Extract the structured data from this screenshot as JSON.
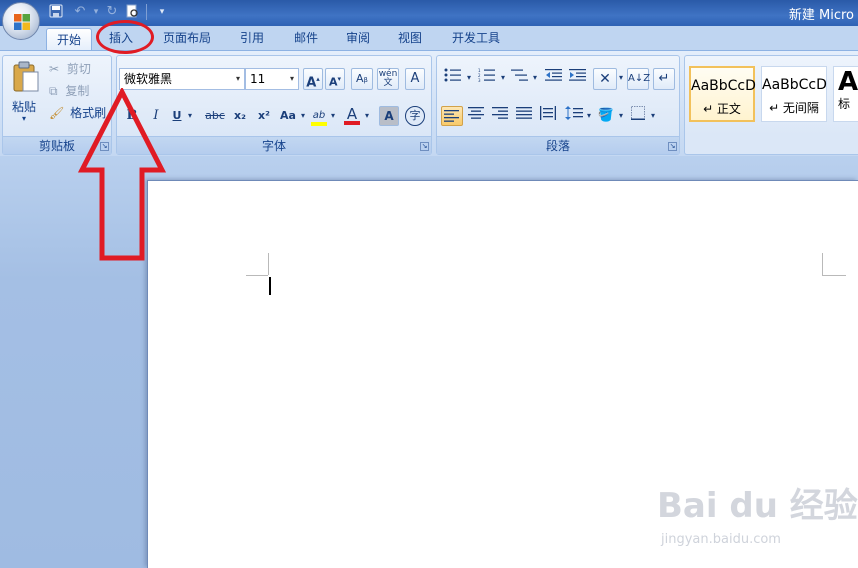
{
  "window": {
    "title": "新建 Micro"
  },
  "tabs": [
    {
      "label": "开始",
      "active": true
    },
    {
      "label": "插入"
    },
    {
      "label": "页面布局"
    },
    {
      "label": "引用"
    },
    {
      "label": "邮件"
    },
    {
      "label": "审阅"
    },
    {
      "label": "视图"
    },
    {
      "label": "开发工具"
    }
  ],
  "clipboard": {
    "group_label": "剪贴板",
    "paste_label": "粘贴",
    "cut_label": "剪切",
    "copy_label": "复制",
    "format_painter_label": "格式刷"
  },
  "font": {
    "group_label": "字体",
    "font_name": "微软雅黑",
    "font_size": "11",
    "wen_label": "wén\n文",
    "char_border_label": "A",
    "bold": "B",
    "italic": "I",
    "underline": "U",
    "strike": "abc",
    "subscript": "x₂",
    "superscript": "x²",
    "case": "Aa",
    "highlight": "ab",
    "font_color": "A",
    "shade": "A",
    "enclose": "字"
  },
  "paragraph": {
    "group_label": "段落"
  },
  "styles": [
    {
      "sample": "AaBbCcD",
      "name": "↵ 正文"
    },
    {
      "sample": "AaBbCcD",
      "name": "↵ 无间隔"
    },
    {
      "sample": "A",
      "name": "标"
    }
  ],
  "colors": {
    "accent": "#e01b24",
    "highlight_yellow": "#ffff00",
    "font_red": "#e01b24"
  },
  "watermark": {
    "main": "Bai du 经验",
    "sub": "jingyan.baidu.com"
  }
}
